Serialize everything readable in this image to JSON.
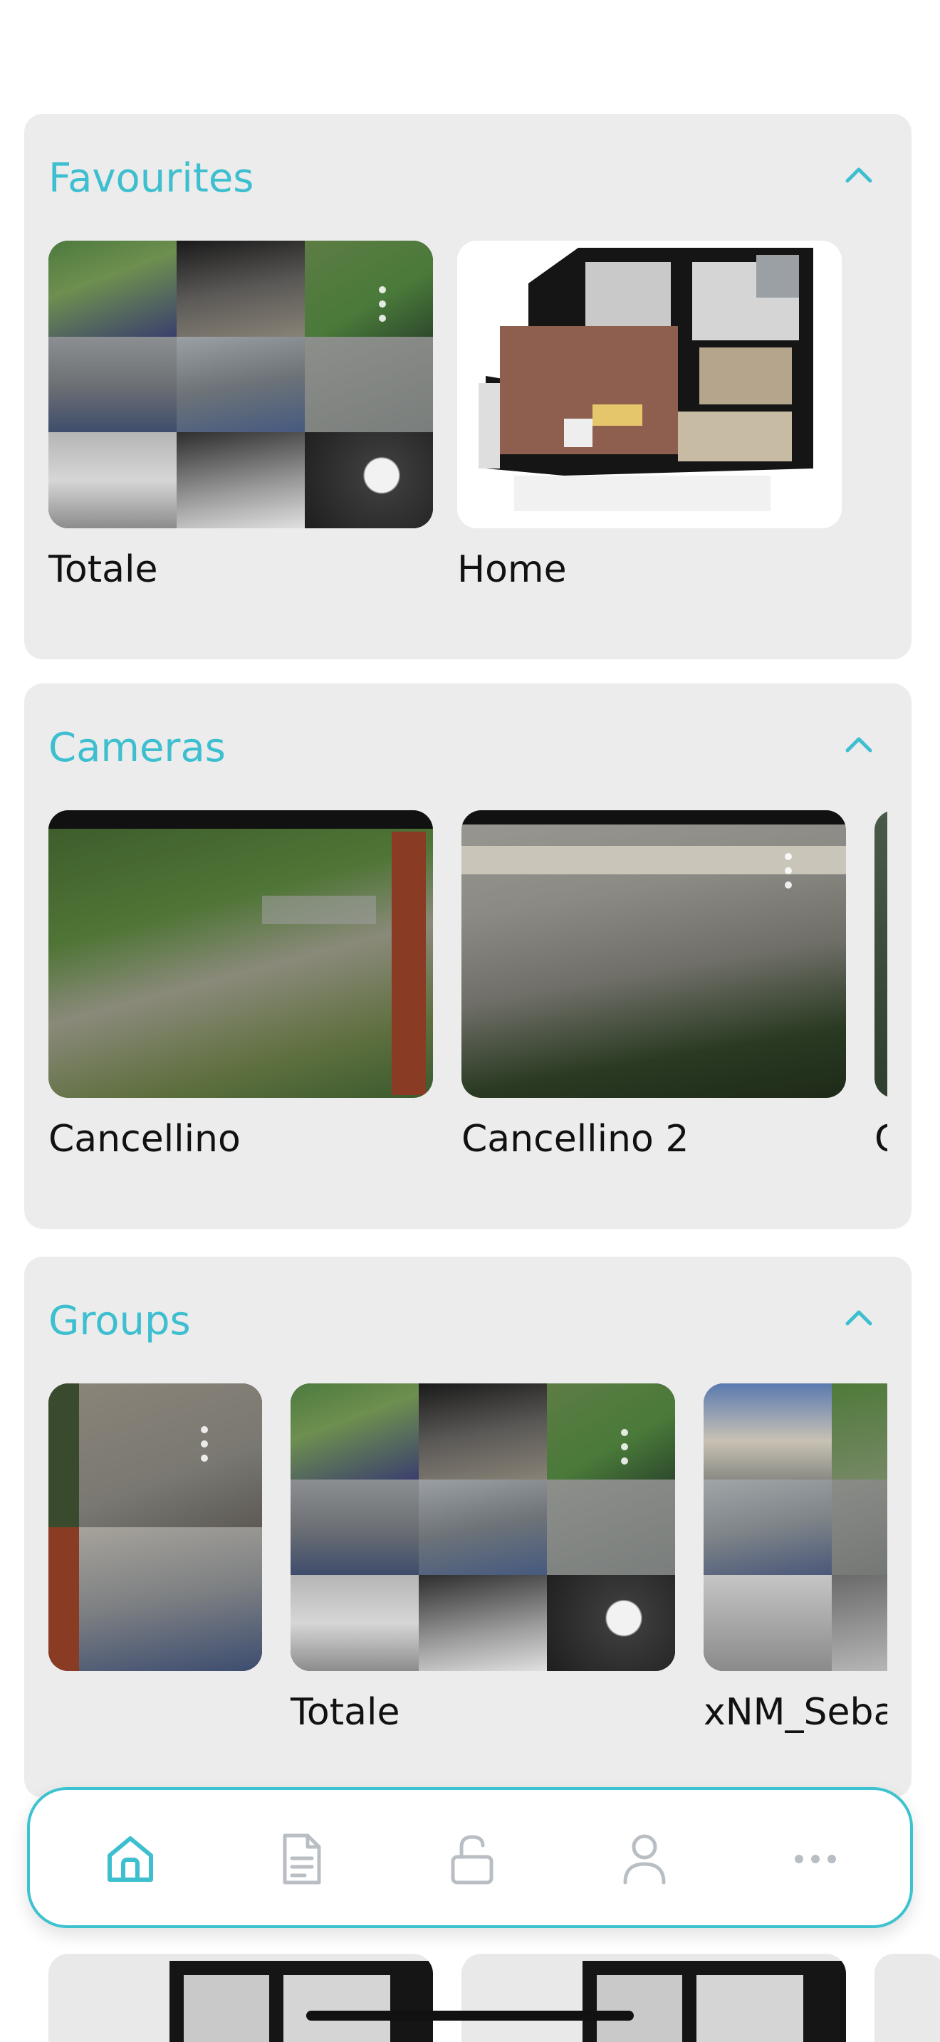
{
  "favourites": {
    "title": "Favourites",
    "items": [
      {
        "label": "Totale"
      },
      {
        "label": "Home"
      }
    ]
  },
  "cameras": {
    "title": "Cameras",
    "items": [
      {
        "label": "Cancellino"
      },
      {
        "label": "Cancellino 2"
      },
      {
        "label": "C"
      }
    ]
  },
  "groups": {
    "title": "Groups",
    "items": [
      {
        "label": ""
      },
      {
        "label": "Totale"
      },
      {
        "label": "xNM_Seba"
      }
    ]
  },
  "nav": {
    "items": [
      {
        "icon": "home-icon",
        "active": true
      },
      {
        "icon": "document-icon",
        "active": false
      },
      {
        "icon": "lock-open-icon",
        "active": false
      },
      {
        "icon": "user-icon",
        "active": false
      },
      {
        "icon": "more-icon",
        "active": false
      }
    ]
  },
  "colors": {
    "accent": "#3dbfcf",
    "section_bg": "#ececec",
    "nav_icon": "#b9bec4"
  }
}
